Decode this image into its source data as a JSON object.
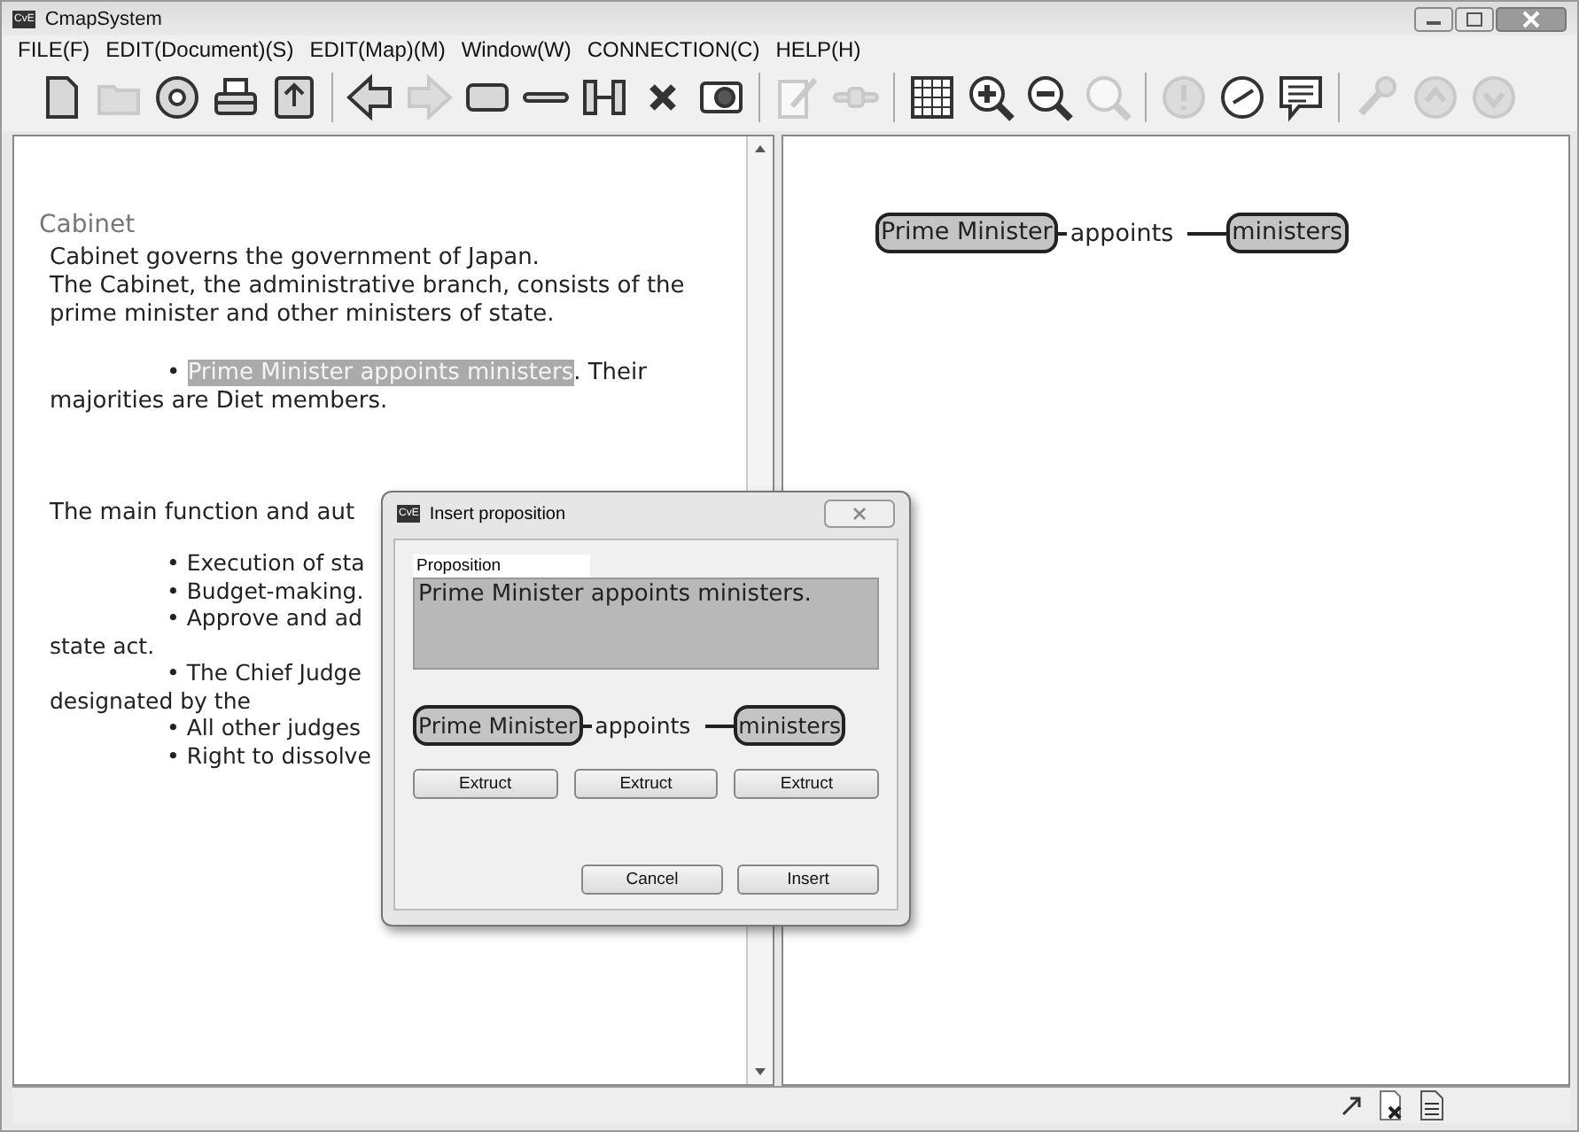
{
  "window": {
    "title": "CmapSystem",
    "app_badge": "CvE"
  },
  "menu": [
    "FILE(F)",
    "EDIT(Document)(S)",
    "EDIT(Map)(M)",
    "Window(W)",
    "CONNECTION(C)",
    "HELP(H)"
  ],
  "toolbar": [
    {
      "kind": "new",
      "disabled": false
    },
    {
      "kind": "folder",
      "disabled": true
    },
    {
      "kind": "disc",
      "disabled": false
    },
    {
      "kind": "printer",
      "disabled": false
    },
    {
      "kind": "export",
      "disabled": false
    },
    {
      "kind": "separator"
    },
    {
      "kind": "left",
      "disabled": false
    },
    {
      "kind": "right",
      "disabled": true
    },
    {
      "kind": "rect",
      "disabled": false
    },
    {
      "kind": "line",
      "disabled": false
    },
    {
      "kind": "link",
      "disabled": false
    },
    {
      "kind": "cross",
      "disabled": false
    },
    {
      "kind": "frame",
      "disabled": false
    },
    {
      "kind": "separator"
    },
    {
      "kind": "pencil",
      "disabled": true
    },
    {
      "kind": "connector",
      "disabled": true
    },
    {
      "kind": "separator"
    },
    {
      "kind": "grid",
      "disabled": false
    },
    {
      "kind": "zoomin",
      "disabled": false
    },
    {
      "kind": "zoomout",
      "disabled": false
    },
    {
      "kind": "search",
      "disabled": true
    },
    {
      "kind": "separator"
    },
    {
      "kind": "alert",
      "disabled": true
    },
    {
      "kind": "clock",
      "disabled": false
    },
    {
      "kind": "comment",
      "disabled": false
    },
    {
      "kind": "separator"
    },
    {
      "kind": "key",
      "disabled": true
    },
    {
      "kind": "up",
      "disabled": true
    },
    {
      "kind": "down",
      "disabled": true
    }
  ],
  "document": {
    "heading": "Cabinet",
    "paragraph": [
      "Cabinet governs the government of Japan.",
      "The Cabinet, the administrative branch, consists of the prime minister and other ministers of state."
    ],
    "bullet": {
      "mark": "•",
      "highlight": "Prime Minister appoints ministers",
      "rest": ". Their majorities are Diet members."
    },
    "intro": "The main function and aut",
    "items": [
      {
        "text": "• Execution of sta",
        "indent": true
      },
      {
        "text": "• Budget-making.",
        "indent": true
      },
      {
        "text": "• Approve and ad",
        "indent": true
      },
      {
        "text": "state act.",
        "indent": false
      },
      {
        "text": "• The Chief Judge",
        "indent": true
      },
      {
        "text": "designated by the",
        "indent": false
      },
      {
        "text": "• All other judges",
        "indent": true
      },
      {
        "text": "• Right to dissolve",
        "indent": true
      }
    ]
  },
  "map": {
    "source": "Prime Minister",
    "link": "appoints",
    "target": "ministers"
  },
  "dialog": {
    "app_badge": "CvE",
    "title": "Insert proposition",
    "field_label": "Proposition",
    "proposition": "Prime Minister appoints ministers.",
    "source": "Prime Minister",
    "link": "appoints",
    "target": "ministers",
    "extract_buttons": [
      "Extruct",
      "Extruct",
      "Extruct"
    ],
    "buttons": [
      "Cancel",
      "Insert"
    ]
  }
}
